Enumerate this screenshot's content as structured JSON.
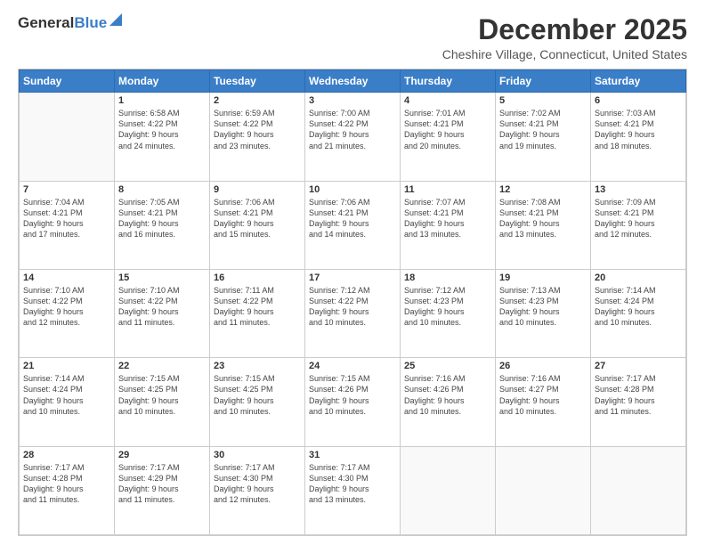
{
  "logo": {
    "general": "General",
    "blue": "Blue"
  },
  "title": "December 2025",
  "subtitle": "Cheshire Village, Connecticut, United States",
  "header_days": [
    "Sunday",
    "Monday",
    "Tuesday",
    "Wednesday",
    "Thursday",
    "Friday",
    "Saturday"
  ],
  "weeks": [
    [
      {
        "day": "",
        "info": ""
      },
      {
        "day": "1",
        "info": "Sunrise: 6:58 AM\nSunset: 4:22 PM\nDaylight: 9 hours\nand 24 minutes."
      },
      {
        "day": "2",
        "info": "Sunrise: 6:59 AM\nSunset: 4:22 PM\nDaylight: 9 hours\nand 23 minutes."
      },
      {
        "day": "3",
        "info": "Sunrise: 7:00 AM\nSunset: 4:22 PM\nDaylight: 9 hours\nand 21 minutes."
      },
      {
        "day": "4",
        "info": "Sunrise: 7:01 AM\nSunset: 4:21 PM\nDaylight: 9 hours\nand 20 minutes."
      },
      {
        "day": "5",
        "info": "Sunrise: 7:02 AM\nSunset: 4:21 PM\nDaylight: 9 hours\nand 19 minutes."
      },
      {
        "day": "6",
        "info": "Sunrise: 7:03 AM\nSunset: 4:21 PM\nDaylight: 9 hours\nand 18 minutes."
      }
    ],
    [
      {
        "day": "7",
        "info": "Sunrise: 7:04 AM\nSunset: 4:21 PM\nDaylight: 9 hours\nand 17 minutes."
      },
      {
        "day": "8",
        "info": "Sunrise: 7:05 AM\nSunset: 4:21 PM\nDaylight: 9 hours\nand 16 minutes."
      },
      {
        "day": "9",
        "info": "Sunrise: 7:06 AM\nSunset: 4:21 PM\nDaylight: 9 hours\nand 15 minutes."
      },
      {
        "day": "10",
        "info": "Sunrise: 7:06 AM\nSunset: 4:21 PM\nDaylight: 9 hours\nand 14 minutes."
      },
      {
        "day": "11",
        "info": "Sunrise: 7:07 AM\nSunset: 4:21 PM\nDaylight: 9 hours\nand 13 minutes."
      },
      {
        "day": "12",
        "info": "Sunrise: 7:08 AM\nSunset: 4:21 PM\nDaylight: 9 hours\nand 13 minutes."
      },
      {
        "day": "13",
        "info": "Sunrise: 7:09 AM\nSunset: 4:21 PM\nDaylight: 9 hours\nand 12 minutes."
      }
    ],
    [
      {
        "day": "14",
        "info": "Sunrise: 7:10 AM\nSunset: 4:22 PM\nDaylight: 9 hours\nand 12 minutes."
      },
      {
        "day": "15",
        "info": "Sunrise: 7:10 AM\nSunset: 4:22 PM\nDaylight: 9 hours\nand 11 minutes."
      },
      {
        "day": "16",
        "info": "Sunrise: 7:11 AM\nSunset: 4:22 PM\nDaylight: 9 hours\nand 11 minutes."
      },
      {
        "day": "17",
        "info": "Sunrise: 7:12 AM\nSunset: 4:22 PM\nDaylight: 9 hours\nand 10 minutes."
      },
      {
        "day": "18",
        "info": "Sunrise: 7:12 AM\nSunset: 4:23 PM\nDaylight: 9 hours\nand 10 minutes."
      },
      {
        "day": "19",
        "info": "Sunrise: 7:13 AM\nSunset: 4:23 PM\nDaylight: 9 hours\nand 10 minutes."
      },
      {
        "day": "20",
        "info": "Sunrise: 7:14 AM\nSunset: 4:24 PM\nDaylight: 9 hours\nand 10 minutes."
      }
    ],
    [
      {
        "day": "21",
        "info": "Sunrise: 7:14 AM\nSunset: 4:24 PM\nDaylight: 9 hours\nand 10 minutes."
      },
      {
        "day": "22",
        "info": "Sunrise: 7:15 AM\nSunset: 4:25 PM\nDaylight: 9 hours\nand 10 minutes."
      },
      {
        "day": "23",
        "info": "Sunrise: 7:15 AM\nSunset: 4:25 PM\nDaylight: 9 hours\nand 10 minutes."
      },
      {
        "day": "24",
        "info": "Sunrise: 7:15 AM\nSunset: 4:26 PM\nDaylight: 9 hours\nand 10 minutes."
      },
      {
        "day": "25",
        "info": "Sunrise: 7:16 AM\nSunset: 4:26 PM\nDaylight: 9 hours\nand 10 minutes."
      },
      {
        "day": "26",
        "info": "Sunrise: 7:16 AM\nSunset: 4:27 PM\nDaylight: 9 hours\nand 10 minutes."
      },
      {
        "day": "27",
        "info": "Sunrise: 7:17 AM\nSunset: 4:28 PM\nDaylight: 9 hours\nand 11 minutes."
      }
    ],
    [
      {
        "day": "28",
        "info": "Sunrise: 7:17 AM\nSunset: 4:28 PM\nDaylight: 9 hours\nand 11 minutes."
      },
      {
        "day": "29",
        "info": "Sunrise: 7:17 AM\nSunset: 4:29 PM\nDaylight: 9 hours\nand 11 minutes."
      },
      {
        "day": "30",
        "info": "Sunrise: 7:17 AM\nSunset: 4:30 PM\nDaylight: 9 hours\nand 12 minutes."
      },
      {
        "day": "31",
        "info": "Sunrise: 7:17 AM\nSunset: 4:30 PM\nDaylight: 9 hours\nand 13 minutes."
      },
      {
        "day": "",
        "info": ""
      },
      {
        "day": "",
        "info": ""
      },
      {
        "day": "",
        "info": ""
      }
    ]
  ]
}
